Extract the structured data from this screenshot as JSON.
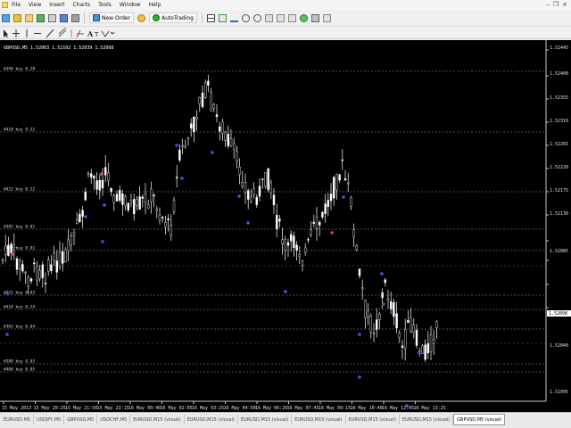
{
  "menu": [
    "File",
    "View",
    "Insert",
    "Charts",
    "Tools",
    "Window",
    "Help"
  ],
  "toolbar": {
    "new_order_label": "New Order",
    "autotrading_label": "AutoTrading",
    "new_order_icon": "new-order-icon",
    "autotrading_icon": "autotrading-icon"
  },
  "chart": {
    "title": "GBPUSD,M5  1.52063  1.52102  1.52039  1.52098",
    "symbol": "GBPUSD",
    "timeframe": "M5",
    "background": "#000000",
    "candle_color": "#ffffff",
    "grid_color": "#9a9a9a",
    "bid_marker_color": "#ffffff"
  },
  "chart_data": {
    "type": "candlestick",
    "grid": true,
    "price_labels": [
      "1.52445",
      "1.52400",
      "1.52355",
      "1.52310",
      "1.52265",
      "1.52220",
      "1.52175",
      "1.52130",
      "1.52098",
      "1.52085",
      "1.52040",
      "1.51995"
    ],
    "current_price": "1.52098",
    "time_labels": [
      "15 May 2013",
      "15 May 20:25",
      "15 May 21:50",
      "15 May 23:15",
      "16 May 00:40",
      "16 May 02:05",
      "16 May 03:25",
      "16 May 04:50",
      "16 May 06:20",
      "16 May 07:45",
      "16 May 09:15",
      "16 May 10:40",
      "16 May 12:05",
      "16 May 13:25"
    ],
    "order_lines": [
      {
        "label": "#398 buy 0.20"
      },
      {
        "label": "#410 buy 0.21"
      },
      {
        "label": "#422 buy 0.22"
      },
      {
        "label": "#385 buy 0.01"
      },
      {
        "label": "#421 buy 0.01"
      },
      {
        "label": "#421 buy 0.03"
      },
      {
        "label": "#418 buy 0.24"
      },
      {
        "label": "#365 buy 0.04"
      },
      {
        "label": "#380 buy 0.03"
      },
      {
        "label": "#468 buy 0.05"
      }
    ]
  },
  "tabs": [
    {
      "label": "EURUSD,M5"
    },
    {
      "label": "USDJPY,M5"
    },
    {
      "label": "GBPUSD,M5"
    },
    {
      "label": "USDCHF,M5"
    },
    {
      "label": "EURUSD,M15 (visual)"
    },
    {
      "label": "EURUSD,M15 (visual)"
    },
    {
      "label": "EURUSD,M15 (visual)"
    },
    {
      "label": "EURUSD,M15 (visual)"
    },
    {
      "label": "EURUSD,M15 (visual)"
    },
    {
      "label": "EURUSD,M15 (visual)"
    },
    {
      "label": "GBPUSD,M5 (visual)"
    }
  ],
  "active_tab": 10
}
